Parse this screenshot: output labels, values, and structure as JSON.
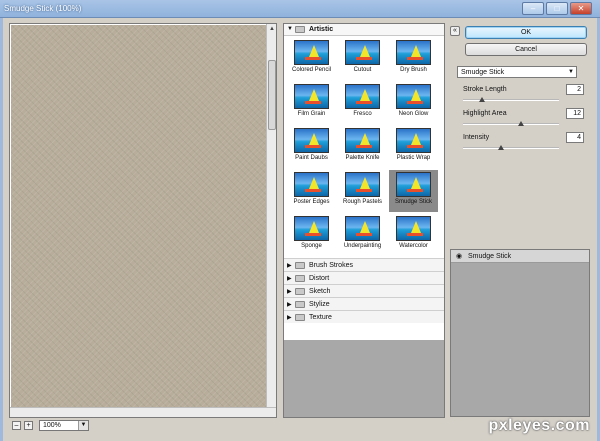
{
  "window": {
    "title": "Smudge Stick (100%)",
    "controls": [
      "–",
      "□",
      "✕"
    ]
  },
  "preview": {
    "zoom_level": "100%",
    "zoom_out_label": "–",
    "zoom_in_label": "+",
    "texture_color": "#b7ad9a"
  },
  "gallery": {
    "open_category": "Artistic",
    "filters": [
      "Colored Pencil",
      "Cutout",
      "Dry Brush",
      "Film Grain",
      "Fresco",
      "Neon Glow",
      "Paint Daubs",
      "Palette Knife",
      "Plastic Wrap",
      "Poster Edges",
      "Rough Pastels",
      "Smudge Stick",
      "Sponge",
      "Underpainting",
      "Watercolor"
    ],
    "selected_filter": "Smudge Stick",
    "categories": [
      "Brush Strokes",
      "Distort",
      "Sketch",
      "Stylize",
      "Texture"
    ]
  },
  "buttons": {
    "ok": "OK",
    "cancel": "Cancel",
    "collapse": "«"
  },
  "settings": {
    "filter_select": "Smudge Stick",
    "params": [
      {
        "label": "Stroke Length",
        "value": "2",
        "fraction": 0.2
      },
      {
        "label": "Highlight Area",
        "value": "12",
        "fraction": 0.6
      },
      {
        "label": "Intensity",
        "value": "4",
        "fraction": 0.4
      }
    ]
  },
  "layers": {
    "items": [
      "Smudge Stick"
    ]
  },
  "watermark": "pxleyes.com"
}
